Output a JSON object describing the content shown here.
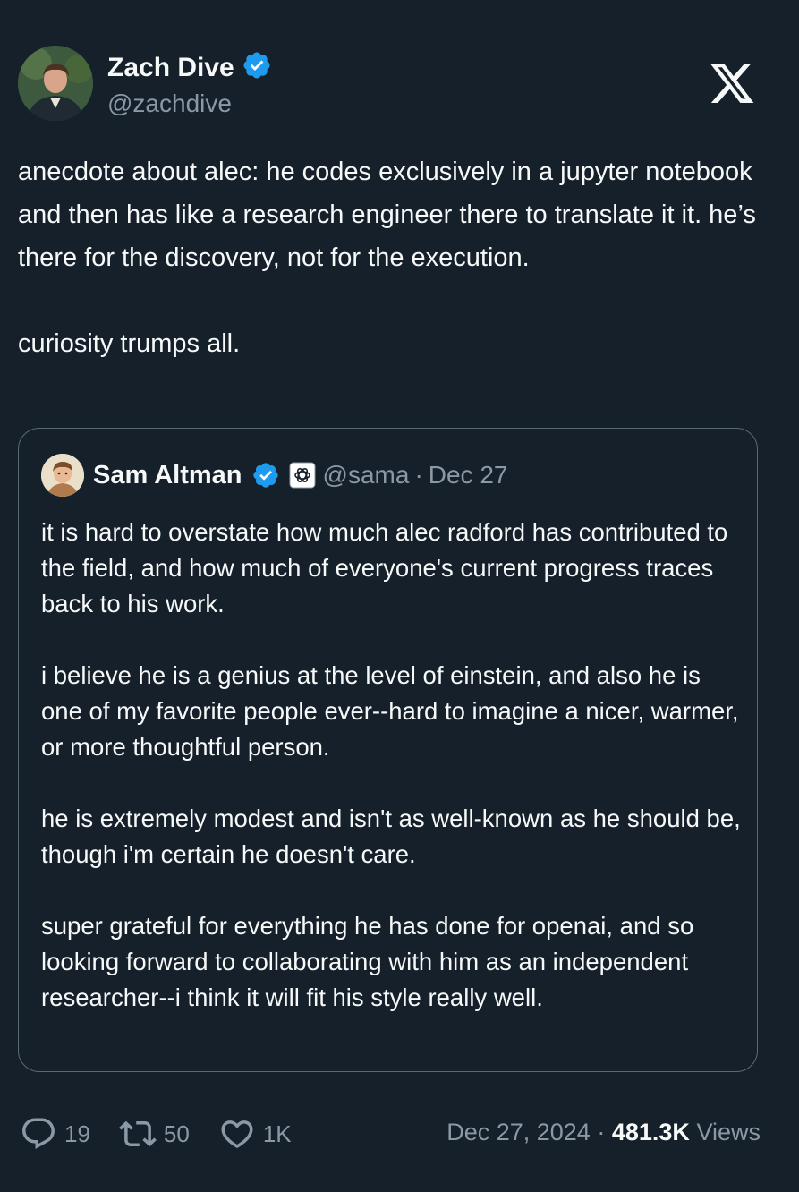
{
  "author": {
    "name": "Zach Dive",
    "handle": "@zachdive"
  },
  "tweet": {
    "text": "anecdote about alec: he codes exclusively in a jupyter notebook and then has like a research engineer there to translate it it. he’s there for the discovery, not for the execution.\n\ncuriosity trumps all."
  },
  "quoted": {
    "name": "Sam Altman",
    "handle": "@sama",
    "separator": "·",
    "date": "Dec 27",
    "text": "it is hard to overstate how much alec radford has contributed to the field, and how much of everyone's current progress traces back to his work.\n\ni believe he is a genius at the level of einstein, and also he is one of my favorite people ever--hard to imagine a nicer, warmer, or more thoughtful person.\n\nhe is extremely modest and isn't as well-known as he should be, though i'm certain he doesn't care.\n\nsuper grateful for everything he has done for openai, and so looking forward to collaborating with him as an independent researcher--i think it will fit his style really well."
  },
  "stats": {
    "replies": "19",
    "retweets": "50",
    "likes": "1K",
    "date": "Dec 27, 2024",
    "separator": "·",
    "views_count": "481.3K",
    "views_label": "Views"
  },
  "colors": {
    "background": "#15202b",
    "text": "#f7f9f9",
    "secondary": "#8b98a5",
    "verified": "#1d9bf0",
    "border": "#5b6976"
  },
  "icons": [
    "verified-badge-icon",
    "x-logo-icon",
    "openai-affiliate-icon",
    "reply-icon",
    "retweet-icon",
    "like-icon"
  ]
}
